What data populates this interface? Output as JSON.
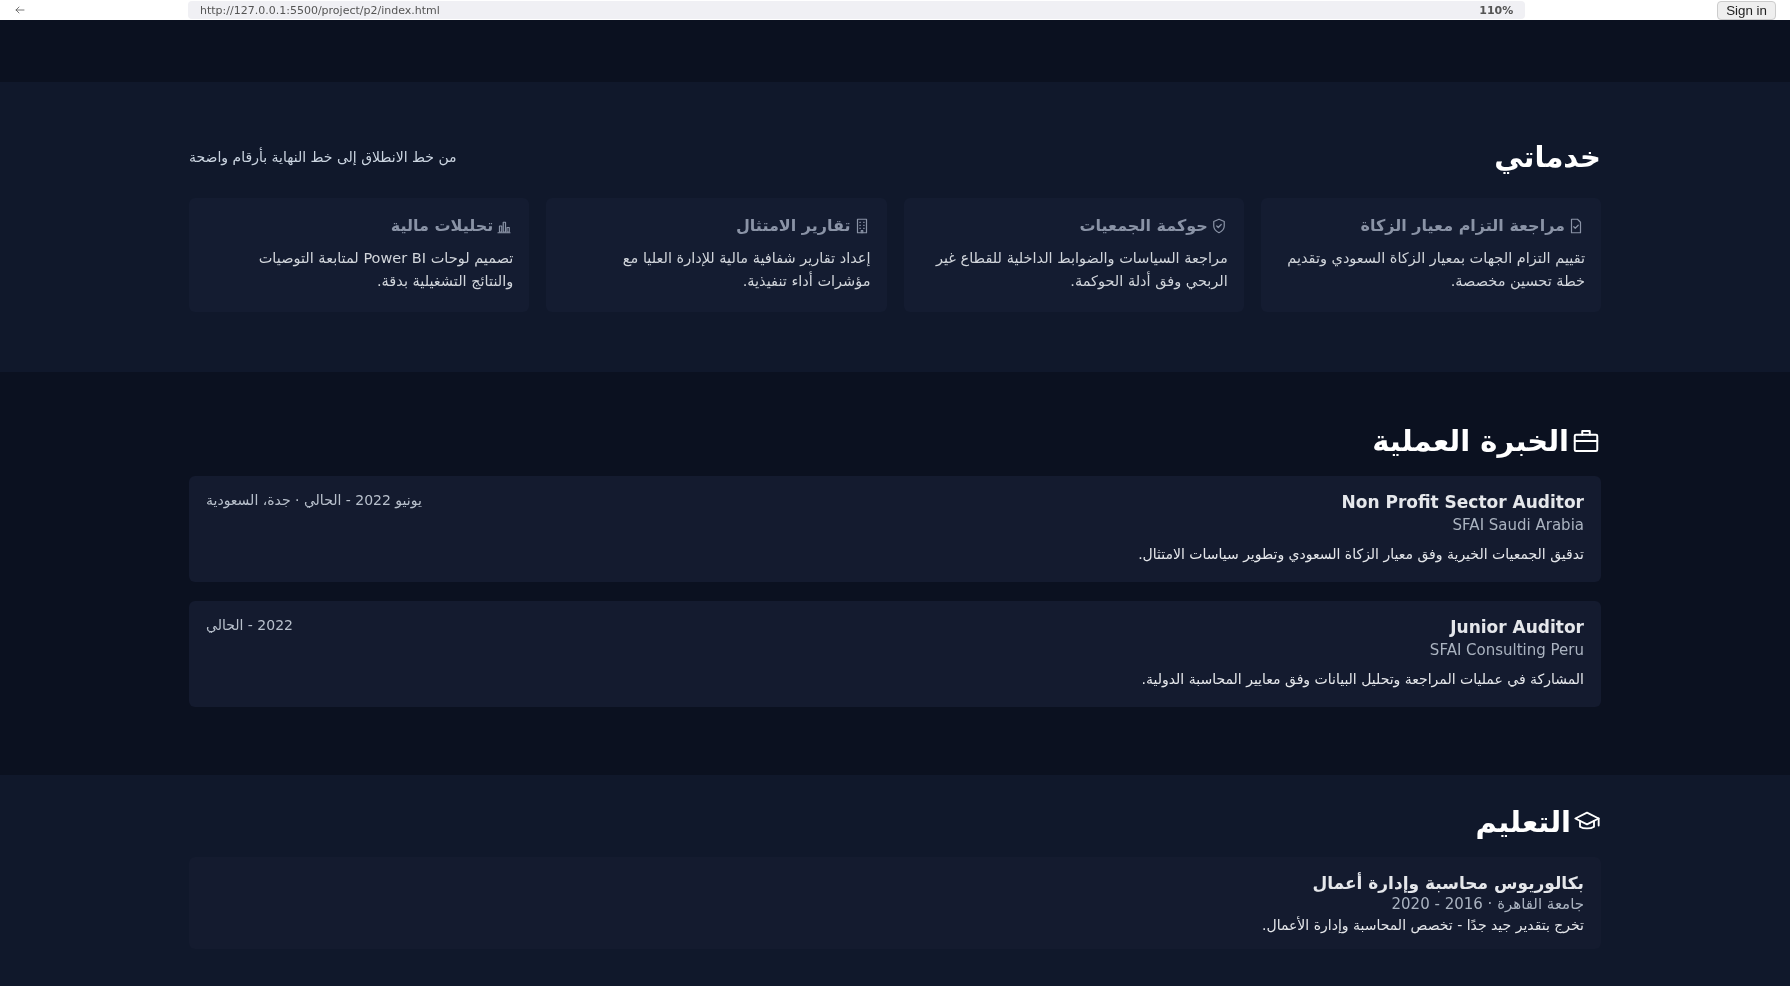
{
  "browser": {
    "url": "http://127.0.0.1:5500/project/p2/index.html",
    "zoom": "110%",
    "sign_in": "Sign in"
  },
  "services": {
    "title": "خدماتي",
    "subtitle": "من خط الانطلاق إلى خط النهاية بأرقام واضحة",
    "items": [
      {
        "title": "مراجعة التزام معيار الزكاة",
        "description": "تقييم التزام الجهات بمعيار الزكاة السعودي وتقديم خطة تحسين مخصصة."
      },
      {
        "title": "حوكمة الجمعيات",
        "description": "مراجعة السياسات والضوابط الداخلية للقطاع غير الربحي وفق أدلة الحوكمة."
      },
      {
        "title": "تقارير الامتثال",
        "description": "إعداد تقارير شفافية مالية للإدارة العليا مع مؤشرات أداء تنفيذية."
      },
      {
        "title": "تحليلات مالية",
        "description": "تصميم لوحات Power BI لمتابعة التوصيات والنتائج التشغيلية بدقة."
      }
    ]
  },
  "experience": {
    "title": "الخبرة العملية",
    "items": [
      {
        "role": "Non Profit Sector Auditor",
        "company": "SFAI Saudi Arabia",
        "period": "يونيو 2022 - الحالي · جدة، السعودية",
        "description": "تدقيق الجمعيات الخيرية وفق معيار الزكاة السعودي وتطوير سياسات الامتثال."
      },
      {
        "role": "Junior Auditor",
        "company": "SFAI Consulting Peru",
        "period": "2022 - الحالي",
        "description": "المشاركة في عمليات المراجعة وتحليل البيانات وفق معايير المحاسبة الدولية."
      }
    ]
  },
  "education": {
    "title": "التعليم",
    "items": [
      {
        "degree": "بكالوريوس محاسبة وإدارة أعمال",
        "meta": "جامعة القاهرة · 2016 - 2020",
        "description": "تخرج بتقدير جيد جدًا - تخصص المحاسبة وإدارة الأعمال."
      }
    ]
  }
}
